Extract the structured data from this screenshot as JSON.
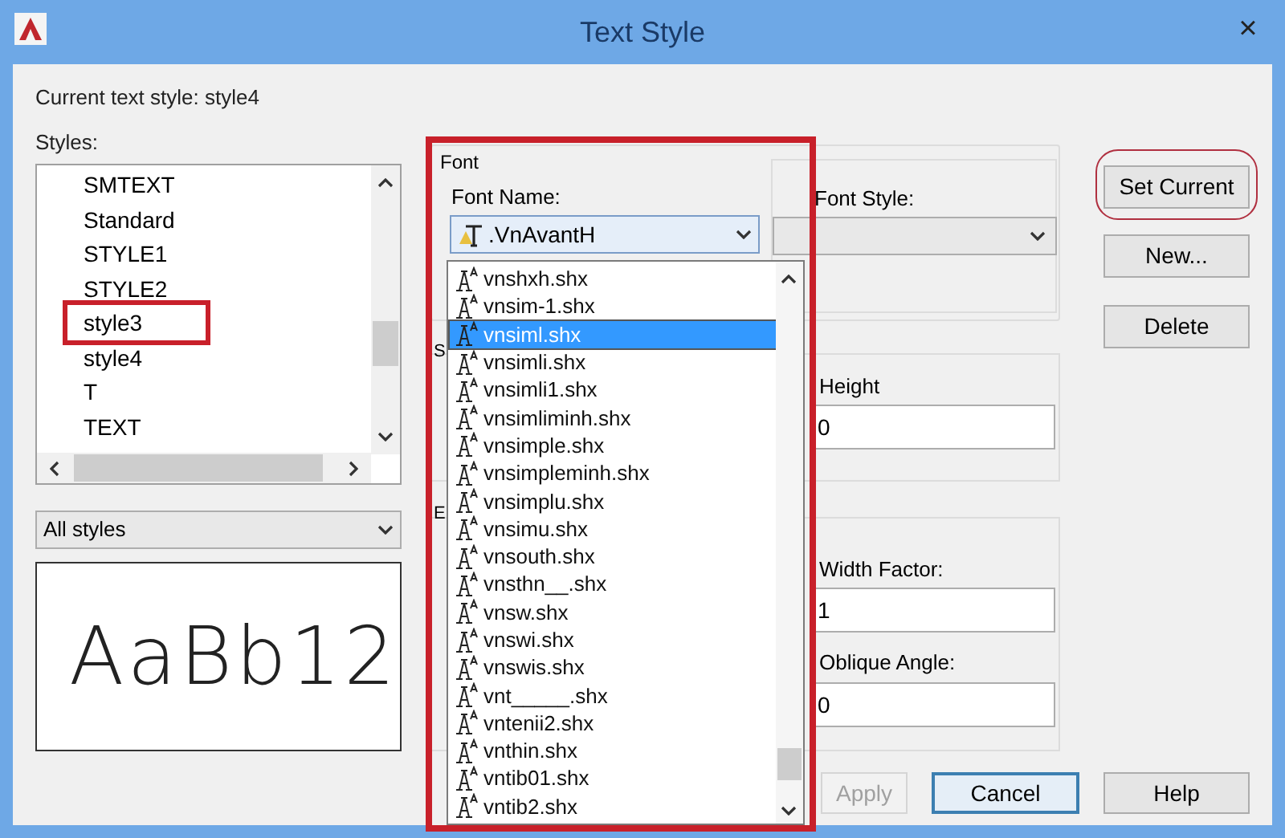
{
  "window": {
    "title": "Text Style",
    "close": "×"
  },
  "current_style": {
    "label": "Current text style:",
    "value": "style4"
  },
  "styles": {
    "label": "Styles:",
    "items": [
      "SMTEXT",
      "Standard",
      "STYLE1",
      "STYLE2",
      "style3",
      "style4",
      "T",
      "TEXT"
    ]
  },
  "style_filter": {
    "value": "All styles"
  },
  "preview": {
    "text": "AaBb12"
  },
  "font": {
    "group_label": "Font",
    "font_name": {
      "label": "Font Name:",
      "value": ".VnAvantH",
      "expanded": true,
      "options": [
        {
          "label": "vnshxh.shx",
          "selected": false
        },
        {
          "label": "vnsim-1.shx",
          "selected": false
        },
        {
          "label": "vnsiml.shx",
          "selected": true
        },
        {
          "label": "vnsimli.shx",
          "selected": false
        },
        {
          "label": "vnsimli1.shx",
          "selected": false
        },
        {
          "label": "vnsimliminh.shx",
          "selected": false
        },
        {
          "label": "vnsimple.shx",
          "selected": false
        },
        {
          "label": "vnsimpleminh.shx",
          "selected": false
        },
        {
          "label": "vnsimplu.shx",
          "selected": false
        },
        {
          "label": "vnsimu.shx",
          "selected": false
        },
        {
          "label": "vnsouth.shx",
          "selected": false
        },
        {
          "label": "vnsthn__.shx",
          "selected": false
        },
        {
          "label": "vnsw.shx",
          "selected": false
        },
        {
          "label": "vnswi.shx",
          "selected": false
        },
        {
          "label": "vnswis.shx",
          "selected": false
        },
        {
          "label": "vnt_____.shx",
          "selected": false
        },
        {
          "label": "vntenii2.shx",
          "selected": false
        },
        {
          "label": "vnthin.shx",
          "selected": false
        },
        {
          "label": "vntib01.shx",
          "selected": false
        },
        {
          "label": "vntib2.shx",
          "selected": false
        }
      ]
    },
    "font_style": {
      "label": "Font Style:"
    }
  },
  "size": {
    "group_label": "S",
    "height": {
      "label": "Height",
      "value": "0"
    }
  },
  "effects": {
    "group_label": "E",
    "width_factor": {
      "label": "Width Factor:",
      "value": "1"
    },
    "oblique_angle": {
      "label": "Oblique Angle:",
      "value": "0"
    }
  },
  "side_buttons": [
    {
      "label": "Set Current"
    },
    {
      "label": "New..."
    },
    {
      "label": "Delete"
    }
  ],
  "bottom_buttons": [
    {
      "label": "Apply",
      "disabled": true,
      "default": false
    },
    {
      "label": "Cancel",
      "disabled": false,
      "default": true
    },
    {
      "label": "Help",
      "disabled": false,
      "default": false
    }
  ]
}
